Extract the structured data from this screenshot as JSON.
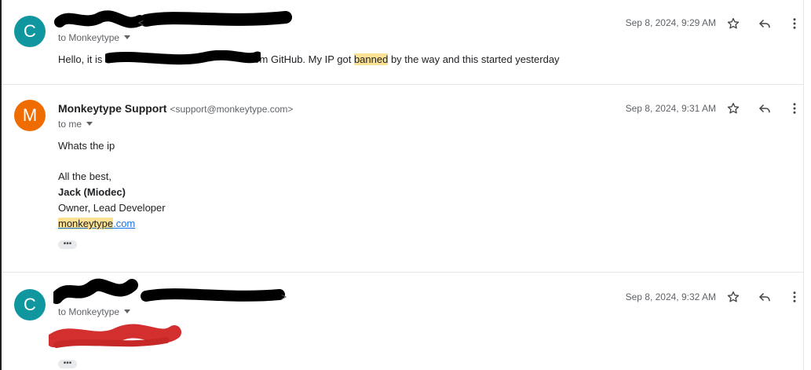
{
  "messages": [
    {
      "avatar_letter": "C",
      "recipient": "to Monkeytype",
      "date": "Sep 8, 2024, 9:29 AM",
      "body": {
        "pre": "Hello, it is ",
        "post_redact": "rom GitHub. My IP got ",
        "highlight": "banned",
        "rest": " by the way and this started yesterday"
      }
    },
    {
      "avatar_letter": "M",
      "sender_name": "Monkeytype Support",
      "sender_email": "<support@monkeytype.com>",
      "recipient": "to me",
      "date": "Sep 8, 2024, 9:31 AM",
      "body": {
        "line1": "Whats the ip",
        "closing": "All the best,",
        "sig_name": "Jack (Miodec)",
        "sig_title": "Owner, Lead Developer",
        "link_highlight": "monkeytype",
        "link_rest": ".com"
      },
      "trimmed": "•••"
    },
    {
      "avatar_letter": "C",
      "sender_suffix": ">",
      "recipient": "to Monkeytype",
      "date": "Sep 8, 2024, 9:32 AM",
      "trimmed": "•••"
    }
  ],
  "icons": {
    "star": "star-icon",
    "reply": "reply-icon",
    "more": "more-vert-icon"
  },
  "colors": {
    "avatar_c": "#0f969f",
    "avatar_m": "#ef6c00",
    "highlight": "#fde293",
    "link": "#1a73e8",
    "redaction_black": "#000000",
    "redaction_red": "#d32f2f"
  }
}
